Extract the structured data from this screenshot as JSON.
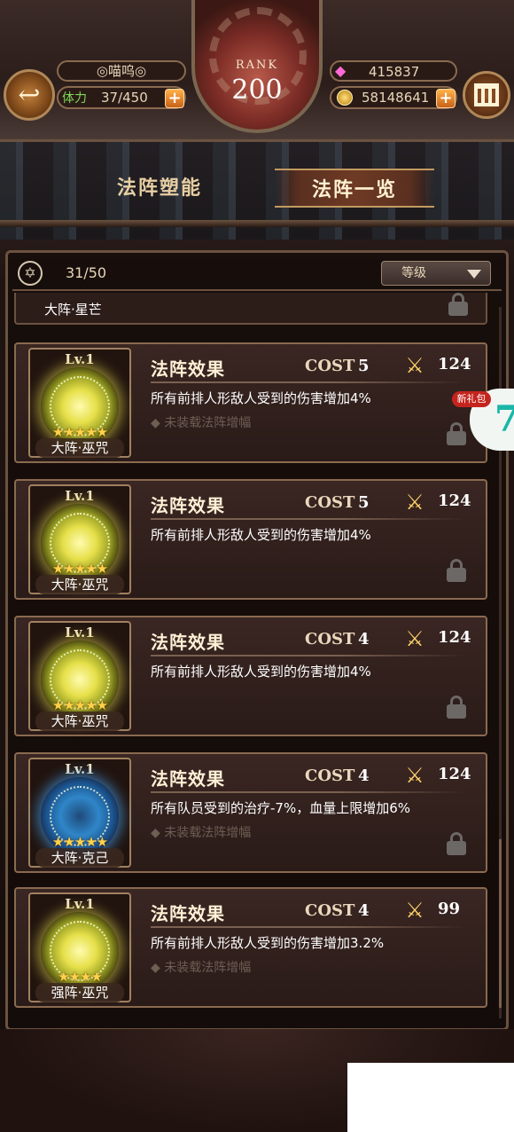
{
  "header": {
    "player_name": "◎喵呜◎",
    "stamina_label": "体力",
    "stamina_value": "37/450",
    "rank_label": "RANK",
    "rank_value": "200",
    "gems": "415837",
    "coins": "58148641"
  },
  "tabs": [
    {
      "label": "法阵塑能",
      "active": false
    },
    {
      "label": "法阵一览",
      "active": true
    }
  ],
  "toolbar": {
    "count": "31/50",
    "sort_label": "等级"
  },
  "partial_card": {
    "name": "大阵·星芒"
  },
  "cards": [
    {
      "level": "Lv.1",
      "stars": "★★★★★",
      "name": "大阵·巫咒",
      "color": "gold",
      "title": "法阵效果",
      "cost_label": "COST",
      "cost": "5",
      "power": "124",
      "desc": "所有前排人形敌人受到的伤害增加4%",
      "sub": "◆ 未装载法阵增幅"
    },
    {
      "level": "Lv.1",
      "stars": "★★★★★",
      "name": "大阵·巫咒",
      "color": "gold",
      "title": "法阵效果",
      "cost_label": "COST",
      "cost": "5",
      "power": "124",
      "desc": "所有前排人形敌人受到的伤害增加4%",
      "sub": ""
    },
    {
      "level": "Lv.1",
      "stars": "★★★★★",
      "name": "大阵·巫咒",
      "color": "gold",
      "title": "法阵效果",
      "cost_label": "COST",
      "cost": "4",
      "power": "124",
      "desc": "所有前排人形敌人受到的伤害增加4%",
      "sub": ""
    },
    {
      "level": "Lv.1",
      "stars": "★★★★★",
      "name": "大阵·克己",
      "color": "blue",
      "title": "法阵效果",
      "cost_label": "COST",
      "cost": "4",
      "power": "124",
      "desc": "所有队员受到的治疗-7%，血量上限增加6%",
      "sub": "◆ 未装载法阵增幅"
    },
    {
      "level": "Lv.1",
      "stars": "★★★★",
      "name": "强阵·巫咒",
      "color": "gold",
      "title": "法阵效果",
      "cost_label": "COST",
      "cost": "4",
      "power": "99",
      "desc": "所有前排人形敌人受到的伤害增加3.2%",
      "sub": "◆ 未装载法阵增幅"
    }
  ],
  "overlay": {
    "badge": "新礼包",
    "side_tab": "7"
  }
}
